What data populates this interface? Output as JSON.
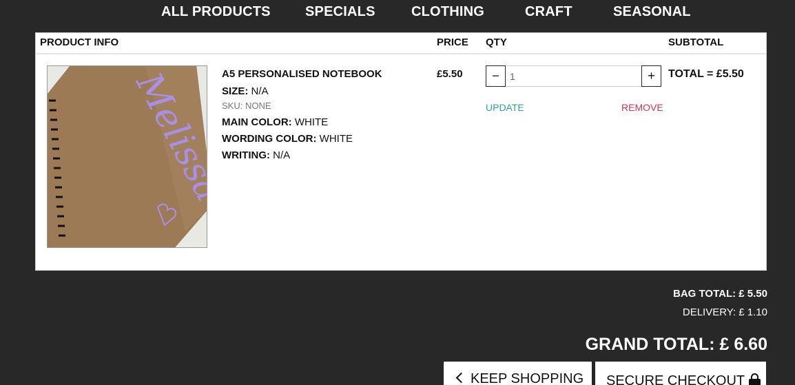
{
  "nav": {
    "items": [
      "ALL PRODUCTS",
      "SPECIALS",
      "CLOTHING",
      "CRAFT",
      "SEASONAL"
    ]
  },
  "table": {
    "headers": {
      "product_info": "PRODUCT INFO",
      "price": "PRICE",
      "qty": "QTY",
      "subtotal": "SUBTOTAL"
    }
  },
  "item": {
    "image_text": "Melissa",
    "name": "A5 PERSONALISED NOTEBOOK",
    "size_label": "SIZE:",
    "size_value": "N/A",
    "sku": "SKU: NONE",
    "main_color_label": "MAIN COLOR:",
    "main_color_value": "WHITE",
    "wording_color_label": "WORDING COLOR:",
    "wording_color_value": "WHITE",
    "writing_label": "WRITING:",
    "writing_value": "N/A",
    "price": "£5.50",
    "qty_minus": "−",
    "qty_plus": "+",
    "qty_value": "1",
    "update_label": "UPDATE",
    "remove_label": "REMOVE",
    "total": "TOTAL = £5.50"
  },
  "summary": {
    "bag_total": "BAG TOTAL: £ 5.50",
    "delivery": "DELIVERY: £ 1.10",
    "grand_total": "GRAND TOTAL: £ 6.60"
  },
  "buttons": {
    "keep_shopping": "KEEP SHOPPING",
    "secure_checkout": "SECURE CHECKOUT"
  },
  "colors": {
    "background": "#282828",
    "update_link": "#2aa1a8",
    "remove_link": "#d6334a",
    "notebook_text": "#a98fe6"
  }
}
